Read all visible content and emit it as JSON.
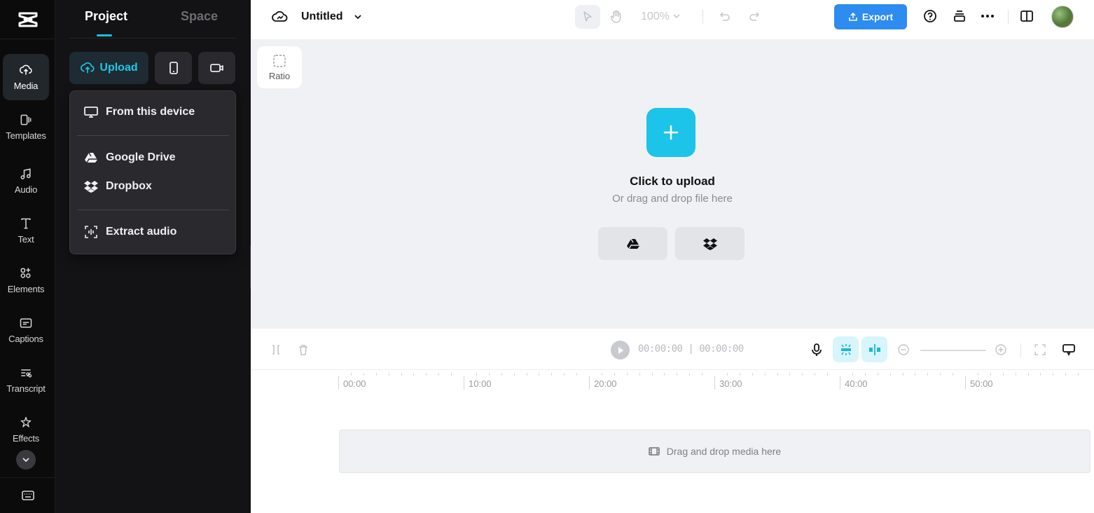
{
  "rail": {
    "items": [
      {
        "label": "Media",
        "icon": "cloud-upload-icon"
      },
      {
        "label": "Templates",
        "icon": "templates-icon"
      },
      {
        "label": "Audio",
        "icon": "music-note-icon"
      },
      {
        "label": "Text",
        "icon": "text-icon"
      },
      {
        "label": "Elements",
        "icon": "elements-icon"
      },
      {
        "label": "Captions",
        "icon": "captions-icon"
      },
      {
        "label": "Transcript",
        "icon": "transcript-icon"
      },
      {
        "label": "Effects",
        "icon": "effects-icon"
      }
    ]
  },
  "panel": {
    "tabs": [
      {
        "label": "Project"
      },
      {
        "label": "Space"
      }
    ],
    "upload_label": "Upload",
    "dropdown": {
      "from_device": "From this device",
      "google_drive": "Google Drive",
      "dropbox": "Dropbox",
      "extract_audio": "Extract audio"
    }
  },
  "topbar": {
    "title": "Untitled",
    "zoom": "100%",
    "export_label": "Export"
  },
  "canvas": {
    "ratio_label": "Ratio",
    "upload_title": "Click to upload",
    "upload_subtitle": "Or drag and drop file here"
  },
  "timeline": {
    "current_time": "00:00:00",
    "separator": "|",
    "total_time": "00:00:00",
    "ruler_labels": [
      "00:00",
      "10:00",
      "20:00",
      "30:00",
      "40:00",
      "50:00"
    ],
    "drop_text": "Drag and drop media here"
  },
  "colors": {
    "accent": "#1bc4e8",
    "export": "#2d8cf0",
    "panel_bg": "#131315",
    "rail_bg": "#0b0b0c",
    "canvas_bg": "#f0f1f4"
  }
}
